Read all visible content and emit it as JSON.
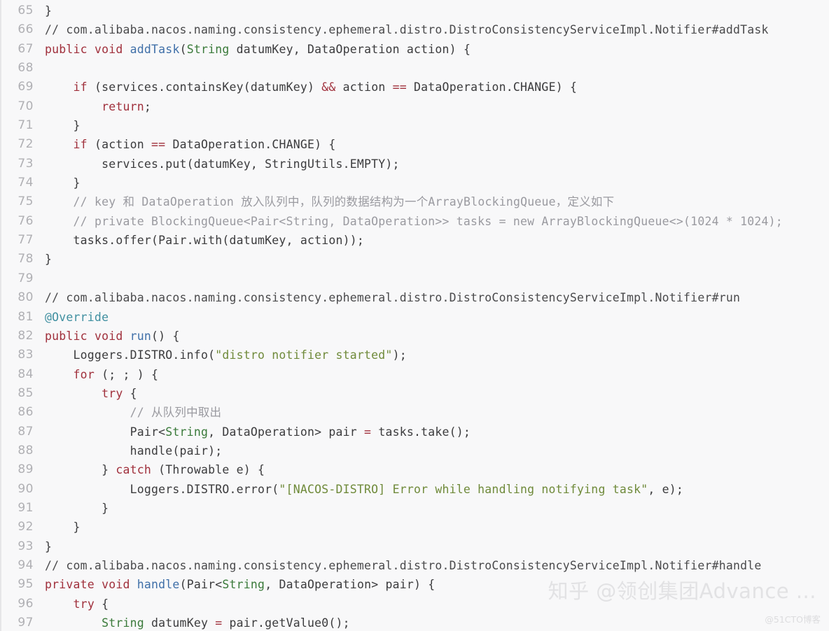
{
  "viewer": {
    "background_color": "#f8f8f9",
    "gutter_color": "#b0b0b4",
    "default_text_color": "#3b3b3d",
    "first_line_number": 65,
    "last_line_number": 97
  },
  "theme": {
    "keyword": "#a0303c",
    "operator": "#a0303c",
    "annotation": "#3f8fa0",
    "method": "#3f6fa8",
    "type": "#3a7a3a",
    "string": "#6f8a3a",
    "comment_dark": "#4a4a4c",
    "comment_grey": "#9a9aa0"
  },
  "lines": [
    {
      "num": "65",
      "tokens": [
        {
          "t": "}",
          "c": "pln"
        }
      ]
    },
    {
      "num": "66",
      "tokens": [
        {
          "t": "// com.alibaba.nacos.naming.consistency.ephemeral.distro.DistroConsistencyServiceImpl.Notifier#addTask",
          "c": "cmt"
        }
      ]
    },
    {
      "num": "67",
      "tokens": [
        {
          "t": "public",
          "c": "kw"
        },
        {
          "t": " ",
          "c": "pln"
        },
        {
          "t": "void",
          "c": "kw"
        },
        {
          "t": " ",
          "c": "pln"
        },
        {
          "t": "addTask",
          "c": "fn"
        },
        {
          "t": "(",
          "c": "pln"
        },
        {
          "t": "String",
          "c": "typ"
        },
        {
          "t": " datumKey, DataOperation action) {",
          "c": "pln"
        }
      ]
    },
    {
      "num": "68",
      "tokens": [
        {
          "t": "",
          "c": "pln"
        }
      ]
    },
    {
      "num": "69",
      "tokens": [
        {
          "t": "    ",
          "c": "pln"
        },
        {
          "t": "if",
          "c": "kw"
        },
        {
          "t": " (services.containsKey(datumKey) ",
          "c": "pln"
        },
        {
          "t": "&&",
          "c": "op"
        },
        {
          "t": " action ",
          "c": "pln"
        },
        {
          "t": "==",
          "c": "op"
        },
        {
          "t": " DataOperation.CHANGE) {",
          "c": "pln"
        }
      ]
    },
    {
      "num": "70",
      "tokens": [
        {
          "t": "        ",
          "c": "pln"
        },
        {
          "t": "return",
          "c": "kw"
        },
        {
          "t": ";",
          "c": "pln"
        }
      ]
    },
    {
      "num": "71",
      "tokens": [
        {
          "t": "    }",
          "c": "pln"
        }
      ]
    },
    {
      "num": "72",
      "tokens": [
        {
          "t": "    ",
          "c": "pln"
        },
        {
          "t": "if",
          "c": "kw"
        },
        {
          "t": " (action ",
          "c": "pln"
        },
        {
          "t": "==",
          "c": "op"
        },
        {
          "t": " DataOperation.CHANGE) {",
          "c": "pln"
        }
      ]
    },
    {
      "num": "73",
      "tokens": [
        {
          "t": "        services.put(datumKey, StringUtils.EMPTY);",
          "c": "pln"
        }
      ]
    },
    {
      "num": "74",
      "tokens": [
        {
          "t": "    }",
          "c": "pln"
        }
      ]
    },
    {
      "num": "75",
      "tokens": [
        {
          "t": "    ",
          "c": "pln"
        },
        {
          "t": "// key 和 DataOperation 放入队列中，队列的数据结构为一个ArrayBlockingQueue，定义如下",
          "c": "cmt2"
        }
      ]
    },
    {
      "num": "76",
      "tokens": [
        {
          "t": "    ",
          "c": "pln"
        },
        {
          "t": "// private BlockingQueue<Pair<String, DataOperation>> tasks = new ArrayBlockingQueue<>(1024 * 1024);",
          "c": "cmt2"
        }
      ]
    },
    {
      "num": "77",
      "tokens": [
        {
          "t": "    tasks.offer(Pair.with(datumKey, action));",
          "c": "pln"
        }
      ]
    },
    {
      "num": "78",
      "tokens": [
        {
          "t": "}",
          "c": "pln"
        }
      ]
    },
    {
      "num": "79",
      "tokens": [
        {
          "t": "",
          "c": "pln"
        }
      ]
    },
    {
      "num": "80",
      "tokens": [
        {
          "t": "// com.alibaba.nacos.naming.consistency.ephemeral.distro.DistroConsistencyServiceImpl.Notifier#run",
          "c": "cmt"
        }
      ]
    },
    {
      "num": "81",
      "tokens": [
        {
          "t": "@Override",
          "c": "ann"
        }
      ]
    },
    {
      "num": "82",
      "tokens": [
        {
          "t": "public",
          "c": "kw"
        },
        {
          "t": " ",
          "c": "pln"
        },
        {
          "t": "void",
          "c": "kw"
        },
        {
          "t": " ",
          "c": "pln"
        },
        {
          "t": "run",
          "c": "fn"
        },
        {
          "t": "() {",
          "c": "pln"
        }
      ]
    },
    {
      "num": "83",
      "tokens": [
        {
          "t": "    Loggers.DISTRO.info(",
          "c": "pln"
        },
        {
          "t": "\"distro notifier started\"",
          "c": "str"
        },
        {
          "t": ");",
          "c": "pln"
        }
      ]
    },
    {
      "num": "84",
      "tokens": [
        {
          "t": "    ",
          "c": "pln"
        },
        {
          "t": "for",
          "c": "kw"
        },
        {
          "t": " (; ; ) {",
          "c": "pln"
        }
      ]
    },
    {
      "num": "85",
      "tokens": [
        {
          "t": "        ",
          "c": "pln"
        },
        {
          "t": "try",
          "c": "kw"
        },
        {
          "t": " {",
          "c": "pln"
        }
      ]
    },
    {
      "num": "86",
      "tokens": [
        {
          "t": "            ",
          "c": "pln"
        },
        {
          "t": "// 从队列中取出",
          "c": "cmt2"
        }
      ]
    },
    {
      "num": "87",
      "tokens": [
        {
          "t": "            Pair<",
          "c": "pln"
        },
        {
          "t": "String",
          "c": "typ"
        },
        {
          "t": ", DataOperation> pair ",
          "c": "pln"
        },
        {
          "t": "=",
          "c": "op"
        },
        {
          "t": " tasks.take();",
          "c": "pln"
        }
      ]
    },
    {
      "num": "88",
      "tokens": [
        {
          "t": "            handle(pair);",
          "c": "pln"
        }
      ]
    },
    {
      "num": "89",
      "tokens": [
        {
          "t": "        } ",
          "c": "pln"
        },
        {
          "t": "catch",
          "c": "kw"
        },
        {
          "t": " (Throwable e) {",
          "c": "pln"
        }
      ]
    },
    {
      "num": "90",
      "tokens": [
        {
          "t": "            Loggers.DISTRO.error(",
          "c": "pln"
        },
        {
          "t": "\"[NACOS-DISTRO] Error while handling notifying task\"",
          "c": "str"
        },
        {
          "t": ", e);",
          "c": "pln"
        }
      ]
    },
    {
      "num": "91",
      "tokens": [
        {
          "t": "        }",
          "c": "pln"
        }
      ]
    },
    {
      "num": "92",
      "tokens": [
        {
          "t": "    }",
          "c": "pln"
        }
      ]
    },
    {
      "num": "93",
      "tokens": [
        {
          "t": "}",
          "c": "pln"
        }
      ]
    },
    {
      "num": "94",
      "tokens": [
        {
          "t": "// com.alibaba.nacos.naming.consistency.ephemeral.distro.DistroConsistencyServiceImpl.Notifier#handle",
          "c": "cmt"
        }
      ]
    },
    {
      "num": "95",
      "tokens": [
        {
          "t": "private",
          "c": "kw"
        },
        {
          "t": " ",
          "c": "pln"
        },
        {
          "t": "void",
          "c": "kw"
        },
        {
          "t": " ",
          "c": "pln"
        },
        {
          "t": "handle",
          "c": "fn"
        },
        {
          "t": "(Pair<",
          "c": "pln"
        },
        {
          "t": "String",
          "c": "typ"
        },
        {
          "t": ", DataOperation> pair) {",
          "c": "pln"
        }
      ]
    },
    {
      "num": "96",
      "tokens": [
        {
          "t": "    ",
          "c": "pln"
        },
        {
          "t": "try",
          "c": "kw"
        },
        {
          "t": " {",
          "c": "pln"
        }
      ]
    },
    {
      "num": "97",
      "tokens": [
        {
          "t": "        ",
          "c": "pln"
        },
        {
          "t": "String",
          "c": "typ"
        },
        {
          "t": " datumKey ",
          "c": "pln"
        },
        {
          "t": "=",
          "c": "op"
        },
        {
          "t": " pair.getValue0();",
          "c": "pln"
        }
      ]
    }
  ],
  "watermarks": {
    "zhihu": "知乎 @领创集团Advance ...",
    "cto51": "@51CTO博客"
  }
}
